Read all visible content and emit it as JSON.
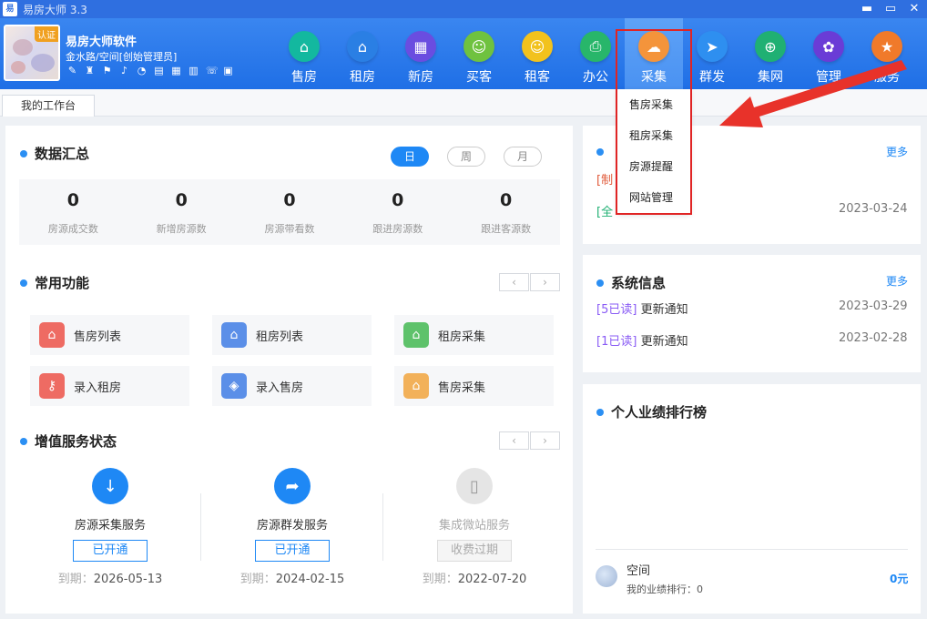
{
  "window": {
    "title": "易房大师 3.3",
    "app_icon": "易",
    "controls": [
      "▬",
      "▭",
      "✕"
    ]
  },
  "brand": {
    "cert": "认证",
    "name": "易房大师软件",
    "sub": "金水路/空间[创始管理员]"
  },
  "toolbar_icons": [
    "edit-icon",
    "shirt-icon",
    "flag-icon",
    "bell-icon",
    "pie-icon",
    "doc-icon",
    "calc-icon",
    "tool-icon",
    "phone-icon",
    "lock-icon"
  ],
  "nav": [
    {
      "label": "售房",
      "color": "#13b89f",
      "glyph": "⌂"
    },
    {
      "label": "租房",
      "color": "#2a7fe4",
      "glyph": "⌂"
    },
    {
      "label": "新房",
      "color": "#6a4de0",
      "glyph": "▦"
    },
    {
      "label": "买客",
      "color": "#6fc23f",
      "glyph": "☺"
    },
    {
      "label": "租客",
      "color": "#f2c21d",
      "glyph": "☺"
    },
    {
      "label": "办公",
      "color": "#28b66a",
      "glyph": "⎙"
    },
    {
      "label": "采集",
      "color": "#f4943b",
      "glyph": "☁"
    },
    {
      "label": "群发",
      "color": "#2e8ff0",
      "glyph": "➤"
    },
    {
      "label": "集网",
      "color": "#20b073",
      "glyph": "⊕"
    },
    {
      "label": "管理",
      "color": "#6a3cd6",
      "glyph": "✿"
    },
    {
      "label": "服务",
      "color": "#f07a2a",
      "glyph": "★"
    }
  ],
  "dropdown": [
    "售房采集",
    "租房采集",
    "房源提醒",
    "网站管理"
  ],
  "tab": "我的工作台",
  "summary": {
    "title": "数据汇总",
    "periods": [
      "日",
      "周",
      "月"
    ],
    "stats": [
      {
        "value": "0",
        "label": "房源成交数"
      },
      {
        "value": "0",
        "label": "新增房源数"
      },
      {
        "value": "0",
        "label": "房源带看数"
      },
      {
        "value": "0",
        "label": "跟进房源数"
      },
      {
        "value": "0",
        "label": "跟进客源数"
      }
    ]
  },
  "functions": {
    "title": "常用功能",
    "items": [
      {
        "label": "售房列表",
        "color": "#ee6b63",
        "glyph": "⌂"
      },
      {
        "label": "租房列表",
        "color": "#5b8fe8",
        "glyph": "⌂"
      },
      {
        "label": "租房采集",
        "color": "#5ec26b",
        "glyph": "⌂"
      },
      {
        "label": "录入租房",
        "color": "#ee6b63",
        "glyph": "⚷"
      },
      {
        "label": "录入售房",
        "color": "#5b8fe8",
        "glyph": "◈"
      },
      {
        "label": "售房采集",
        "color": "#f2b15a",
        "glyph": "⌂"
      }
    ]
  },
  "services": {
    "title": "增值服务状态",
    "items": [
      {
        "name": "房源采集服务",
        "status": "已开通",
        "prefix": "到期：",
        "date": "2026-05-13",
        "color": "#1e88f5",
        "glyph": "↓"
      },
      {
        "name": "房源群发服务",
        "status": "已开通",
        "prefix": "到期：",
        "date": "2024-02-15",
        "color": "#1e88f5",
        "glyph": "➦"
      },
      {
        "name": "集成微站服务",
        "status": "收费过期",
        "prefix": "到期：",
        "date": "2022-07-20",
        "color": "#e5e5e5",
        "glyph": "▯"
      }
    ]
  },
  "notice": {
    "more": "更多",
    "rows": [
      {
        "tag": "[制",
        "text": ""
      },
      {
        "tag": "[全",
        "text": "",
        "date": "2023-03-24"
      }
    ]
  },
  "system": {
    "title": "系统信息",
    "more": "更多",
    "rows": [
      {
        "tag": "[5已读]",
        "text": "更新通知",
        "date": "2023-03-29"
      },
      {
        "tag": "[1已读]",
        "text": "更新通知",
        "date": "2023-02-28"
      }
    ]
  },
  "ranking": {
    "title": "个人业绩排行榜",
    "user": "空间",
    "sub": "我的业绩排行：0",
    "amount": "0元"
  },
  "prev_glyph": "‹",
  "next_glyph": "›"
}
